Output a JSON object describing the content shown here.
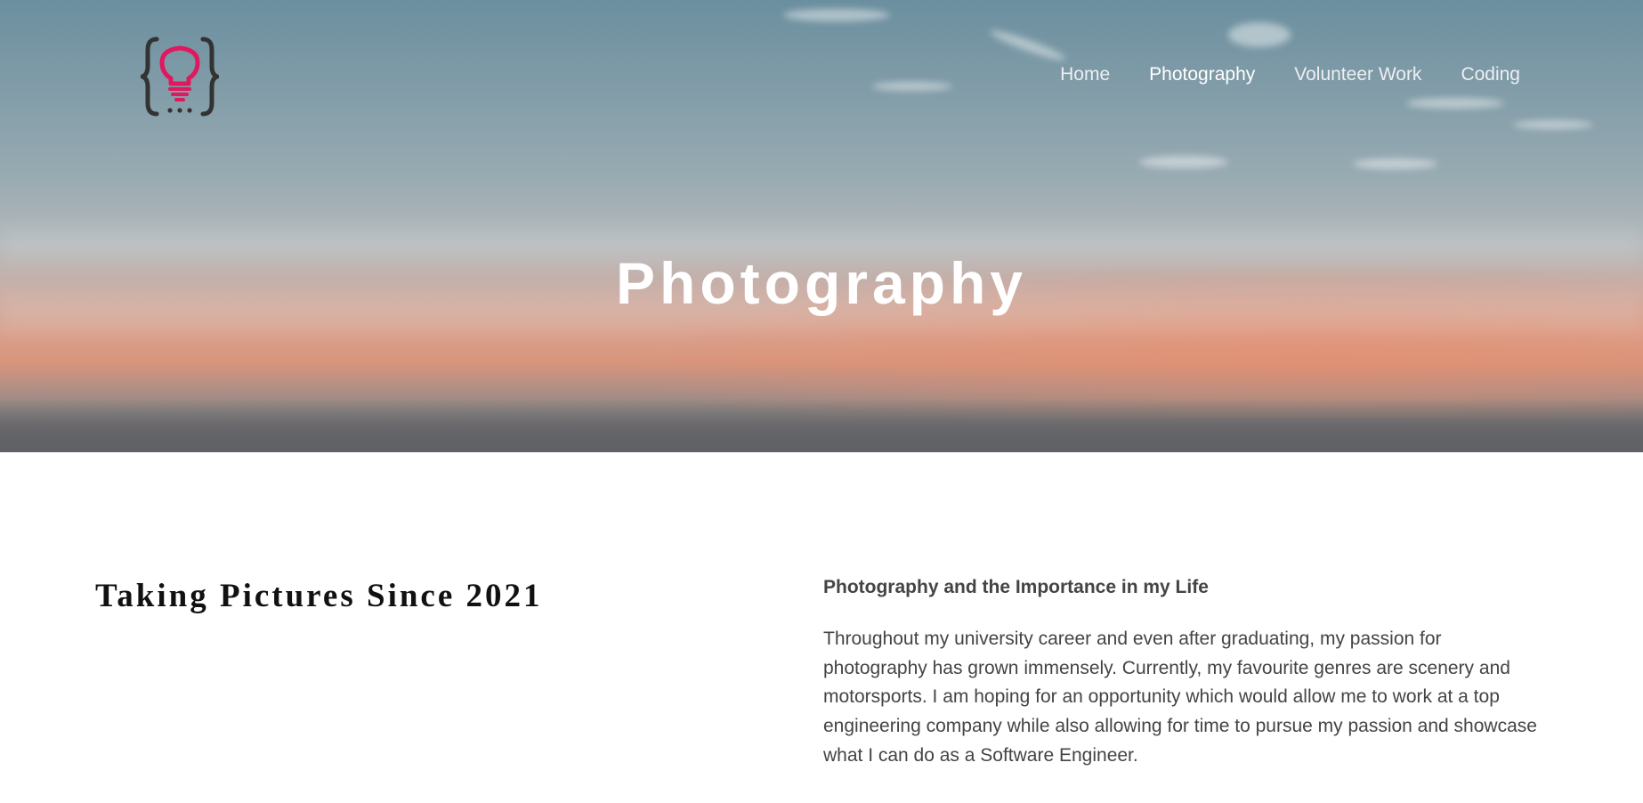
{
  "nav": {
    "items": [
      {
        "label": "Home",
        "active": false
      },
      {
        "label": "Photography",
        "active": true
      },
      {
        "label": "Volunteer Work",
        "active": false
      },
      {
        "label": "Coding",
        "active": false
      }
    ]
  },
  "hero": {
    "title": "Photography"
  },
  "main": {
    "heading": "Taking Pictures Since 2021",
    "subheading": "Photography and the Importance in my Life",
    "paragraph": "Throughout my university career and even after graduating, my passion for photography has grown immensely. Currently, my favourite genres are scenery and motorsports. I am hoping for an opportunity which would allow me to work at a top engineering company while also allowing for time to pursue my passion and showcase what I can do as a Software Engineer."
  },
  "colors": {
    "logo_accent": "#e0185e",
    "logo_brace": "#333333",
    "body_text": "#444444"
  },
  "icons": {
    "logo": "lightbulb-in-braces-icon"
  }
}
